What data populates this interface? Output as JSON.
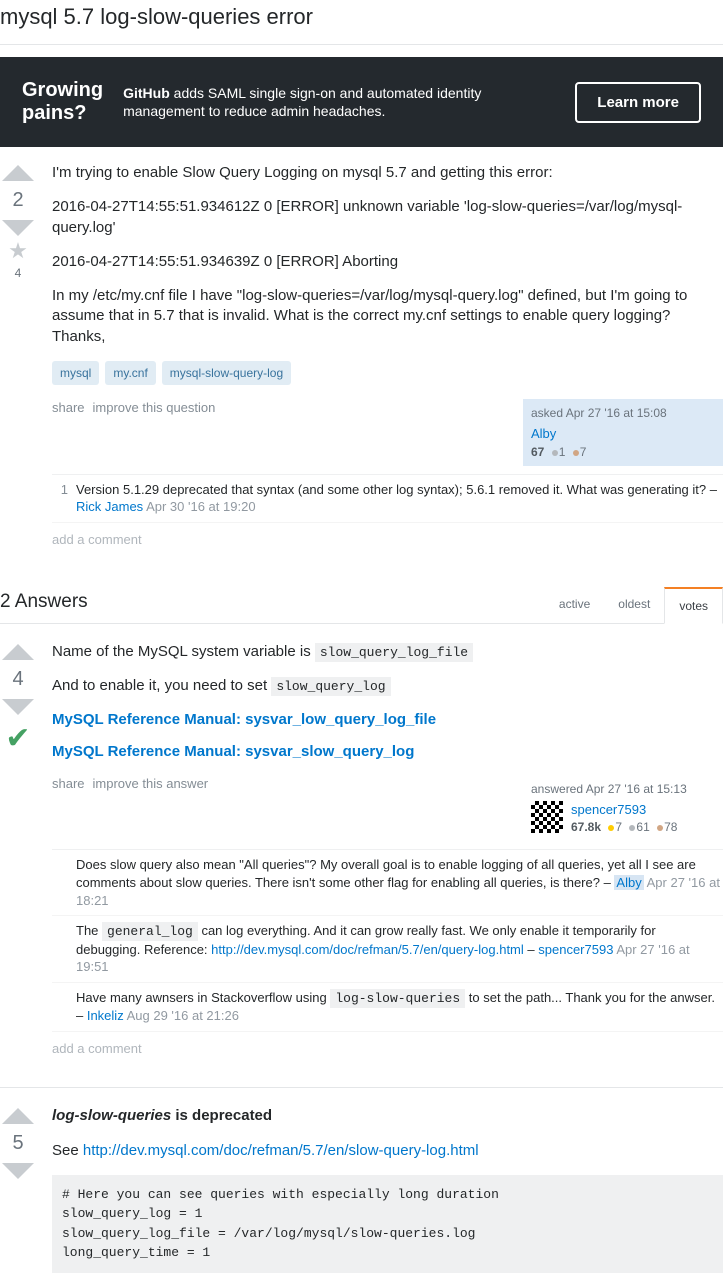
{
  "question": {
    "title": "mysql 5.7 log-slow-queries error",
    "body_p1": "I'm trying to enable Slow Query Logging on mysql 5.7 and getting this error:",
    "body_p2": "2016-04-27T14:55:51.934612Z 0 [ERROR] unknown variable 'log-slow-queries=/var/log/mysql-query.log'",
    "body_p3": "2016-04-27T14:55:51.934639Z 0 [ERROR] Aborting",
    "body_p4": "In my /etc/my.cnf file I have \"log-slow-queries=/var/log/mysql-query.log\" defined, but I'm going to assume that in 5.7 that is invalid. What is the correct my.cnf settings to enable query logging? Thanks,",
    "tags": [
      "mysql",
      "my.cnf",
      "mysql-slow-query-log"
    ],
    "votes": "2",
    "favs": "4",
    "actions": {
      "share": "share",
      "improve": "improve this question"
    },
    "asked_label": "asked Apr 27 '16 at 15:08",
    "user": {
      "name": "Alby",
      "rep": "67",
      "silver": "1",
      "bronze": "7"
    },
    "comments": [
      {
        "score": "1",
        "text": "Version 5.1.29 deprecated that syntax (and some other log syntax); 5.6.1 removed it. What was generating it? – ",
        "user": "Rick James",
        "time": "Apr 30 '16 at 19:20"
      }
    ],
    "addc": "add a comment"
  },
  "ad": {
    "headline1": "Growing",
    "headline2": "pains?",
    "brand": "GitHub",
    "copy": " adds SAML single sign-on and automated identity management to reduce admin headaches.",
    "cta": "Learn more"
  },
  "answers_header": {
    "count": "2 Answers",
    "tabs": {
      "active": "active",
      "oldest": "oldest",
      "votes": "votes"
    }
  },
  "answer1": {
    "votes": "4",
    "p1_a": "Name of the MySQL system variable is ",
    "p1_code": "slow_query_log_file",
    "p2_a": "And to enable it, you need to set ",
    "p2_code": "slow_query_log",
    "ref1": "MySQL Reference Manual: sysvar_low_query_log_file",
    "ref2": "MySQL Reference Manual: sysvar_slow_query_log",
    "actions": {
      "share": "share",
      "improve": "improve this answer"
    },
    "answered_label": "answered Apr 27 '16 at 15:13",
    "user": {
      "name": "spencer7593",
      "rep": "67.8k",
      "gold": "7",
      "silver": "61",
      "bronze": "78"
    },
    "comments": [
      {
        "text": "Does slow query also mean \"All queries\"? My overall goal is to enable logging of all queries, yet all I see are comments about slow queries. There isn't some other flag for enabling all queries, is there? – ",
        "user": "Alby",
        "time": "Apr 27 '16 at 18:21",
        "hl": true
      },
      {
        "pre": "The ",
        "code": "general_log",
        "mid": " can log everything. And it can grow really fast. We only enable it temporarily for debugging. Reference: ",
        "link": "http://dev.mysql.com/doc/refman/5.7/en/query-log.html",
        "sep": " – ",
        "user": "spencer7593",
        "time": "Apr 27 '16 at 19:51"
      },
      {
        "pre": "Have many awnsers in Stackoverflow using ",
        "code": "log-slow-queries",
        "mid": " to set the path... Thank you for the anwser. – ",
        "user": "Inkeliz",
        "time": "Aug 29 '16 at 21:26"
      }
    ],
    "addc": "add a comment"
  },
  "answer2": {
    "votes": "5",
    "p1_code": "log-slow-queries",
    "p1_b": " is deprecated",
    "p2_a": "See ",
    "p2_link": "http://dev.mysql.com/doc/refman/5.7/en/slow-query-log.html",
    "code": "# Here you can see queries with especially long duration\nslow_query_log = 1\nslow_query_log_file = /var/log/mysql/slow-queries.log\nlong_query_time = 1"
  }
}
